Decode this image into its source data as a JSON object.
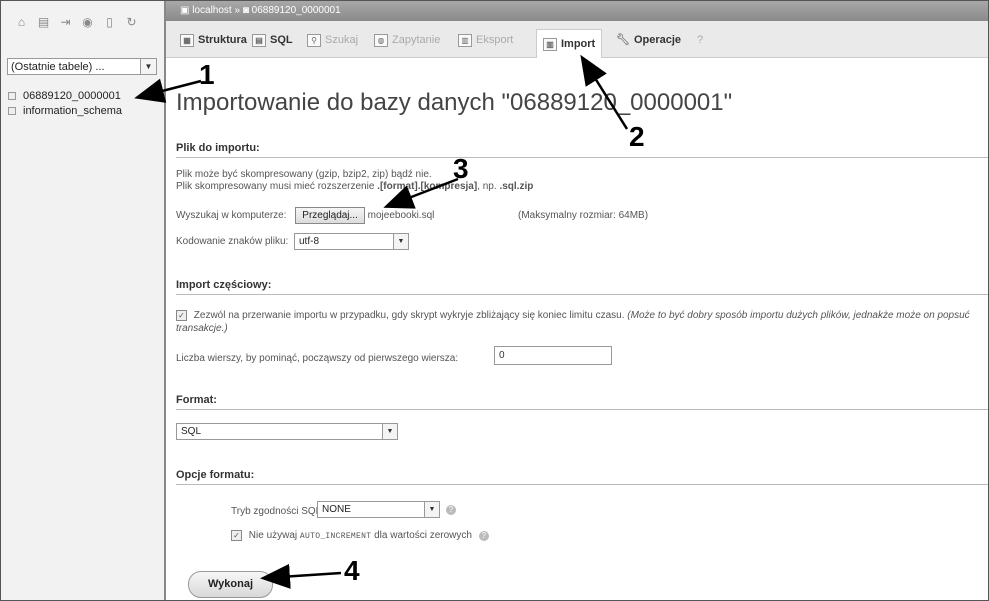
{
  "sidebar": {
    "icons": [
      "home-icon",
      "sql-window-icon",
      "logout-icon",
      "help-icon",
      "docs-icon",
      "reload-icon"
    ],
    "select_value": "(Ostatnie tabele) ...",
    "databases": [
      "06889120_0000001",
      "information_schema"
    ]
  },
  "breadcrumb": {
    "server": "localhost",
    "separator": "»",
    "database": "06889120_0000001"
  },
  "tabs": [
    {
      "label": "Struktura",
      "icon": "structure-icon"
    },
    {
      "label": "SQL",
      "icon": "sql-icon"
    },
    {
      "label": "Szukaj",
      "icon": "search-icon"
    },
    {
      "label": "Zapytanie",
      "icon": "query-icon"
    },
    {
      "label": "Eksport",
      "icon": "export-icon"
    },
    {
      "label": "Import",
      "icon": "import-icon"
    },
    {
      "label": "Operacje",
      "icon": "wrench-icon"
    },
    {
      "label": "?",
      "icon": ""
    }
  ],
  "page_title": "Importowanie do bazy danych \"06889120_0000001\"",
  "file_section": {
    "heading": "Plik do importu:",
    "line1": "Plik może być skompresowany (gzip, bzip2, zip) bądź nie.",
    "line2_prefix": "Plik skompresowany musi mieć rozszerzenie ",
    "line2_ext": ".[format].[kompresja]",
    "line2_mid": ", np. ",
    "line2_example": ".sql.zip",
    "browse_label": "Wyszukaj w komputerze:",
    "browse_button": "Przeglądaj...",
    "file_name": "mojeebooki.sql",
    "max_size": "(Maksymalny rozmiar: 64MB)",
    "charset_label": "Kodowanie znaków pliku:",
    "charset_value": "utf-8"
  },
  "partial_section": {
    "heading": "Import częściowy:",
    "allow_interrupt": "Zezwól na przerwanie importu w przypadku, gdy skrypt wykryje zbliżający się koniec limitu czasu.",
    "allow_interrupt_note": "(Może to być dobry sposób importu dużych plików, jednakże może on popsuć transakcje.)",
    "allow_interrupt_checked": true,
    "skip_label": "Liczba wierszy, by pominąć, począwszy od pierwszego wiersza:",
    "skip_value": "0"
  },
  "format_section": {
    "heading": "Format:",
    "value": "SQL"
  },
  "format_options": {
    "heading": "Opcje formatu:",
    "compat_label": "Tryb zgodności SQL:",
    "compat_value": "NONE",
    "no_auto_prefix": "Nie używaj",
    "no_auto_code": "AUTO_INCREMENT",
    "no_auto_suffix": "dla wartości zerowych",
    "no_auto_checked": true
  },
  "submit_label": "Wykonaj",
  "annotations": [
    "1",
    "2",
    "3",
    "4"
  ]
}
